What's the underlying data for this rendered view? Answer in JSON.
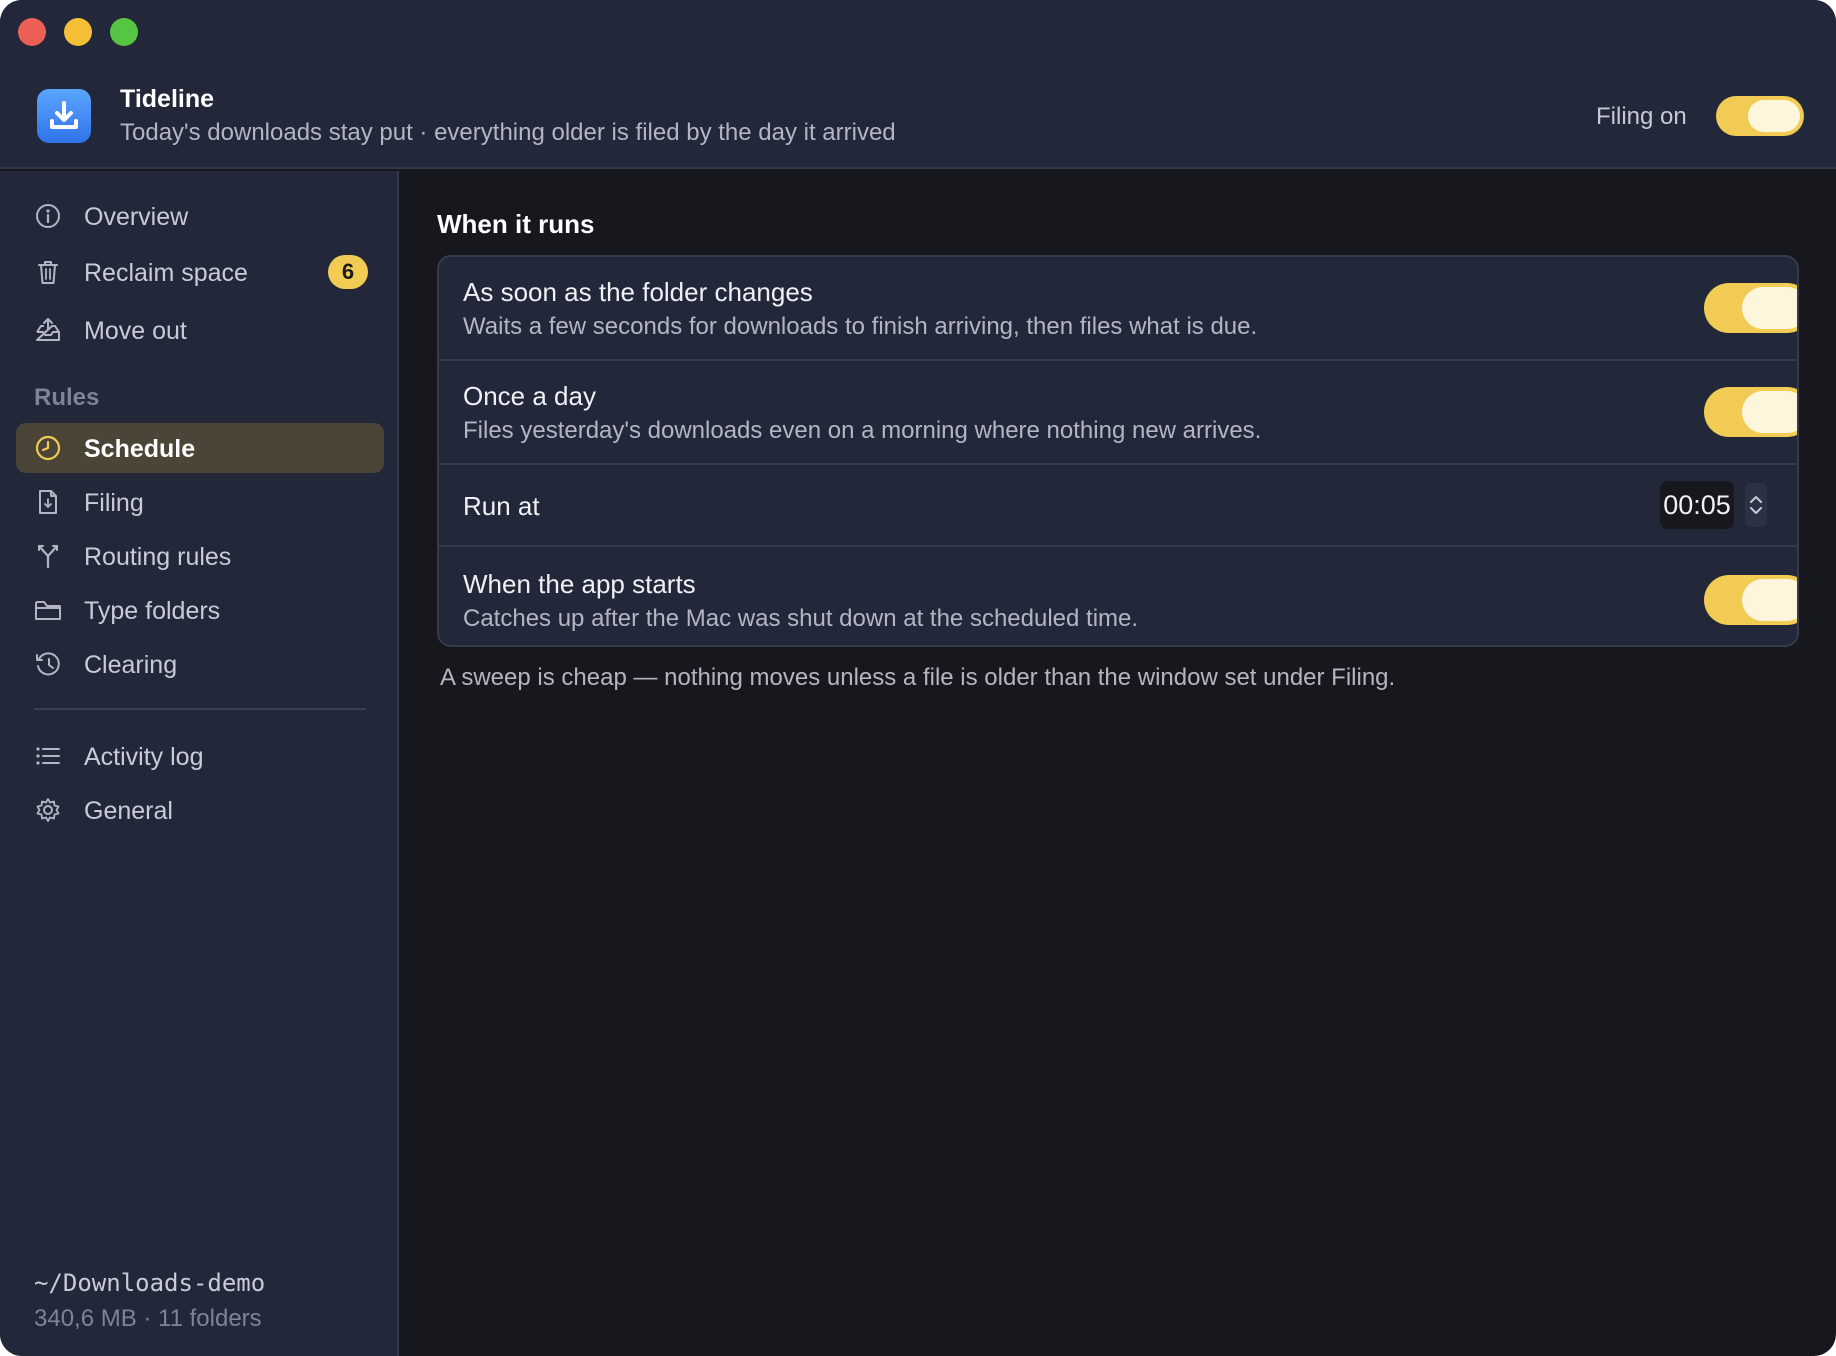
{
  "header": {
    "title": "Tideline",
    "subtitle": "Today's downloads stay put · everything older is filed by the day it arrived",
    "filing_label": "Filing on",
    "filing_on": true,
    "app_icon": "download-icon"
  },
  "sidebar": {
    "items_top": [
      {
        "label": "Overview",
        "icon": "info-icon"
      },
      {
        "label": "Reclaim space",
        "icon": "trash-icon",
        "badge": "6"
      },
      {
        "label": "Move out",
        "icon": "tray-out-icon"
      }
    ],
    "section_label": "Rules",
    "items_rules": [
      {
        "label": "Schedule",
        "icon": "clock-icon",
        "active": true
      },
      {
        "label": "Filing",
        "icon": "document-icon"
      },
      {
        "label": "Routing rules",
        "icon": "fork-icon"
      },
      {
        "label": "Type folders",
        "icon": "folder-icon"
      },
      {
        "label": "Clearing",
        "icon": "history-icon"
      }
    ],
    "items_bottom": [
      {
        "label": "Activity log",
        "icon": "list-icon"
      },
      {
        "label": "General",
        "icon": "gear-icon"
      }
    ],
    "folder_path": "~/Downloads-demo",
    "folder_stats": "340,6 MB · 11 folders"
  },
  "main": {
    "section_title": "When it runs",
    "rows": [
      {
        "title": "As soon as the folder changes",
        "desc": "Waits a few seconds for downloads to finish arriving, then files what is due.",
        "enabled": true
      },
      {
        "title": "Once a day",
        "desc": "Files yesterday's downloads even on a morning where nothing new arrives.",
        "enabled": true
      },
      {
        "title": "Run at",
        "time": "00:05"
      },
      {
        "title": "When the app starts",
        "desc": "Catches up after the Mac was shut down at the scheduled time.",
        "enabled": true
      }
    ],
    "footnote": "A sweep is cheap — nothing moves unless a file is older than the window set under Filing."
  },
  "colors": {
    "accent": "#f2cb55",
    "sidebar_bg": "#22273a",
    "content_bg": "#17181d",
    "active_item_bg": "#4b4537"
  }
}
